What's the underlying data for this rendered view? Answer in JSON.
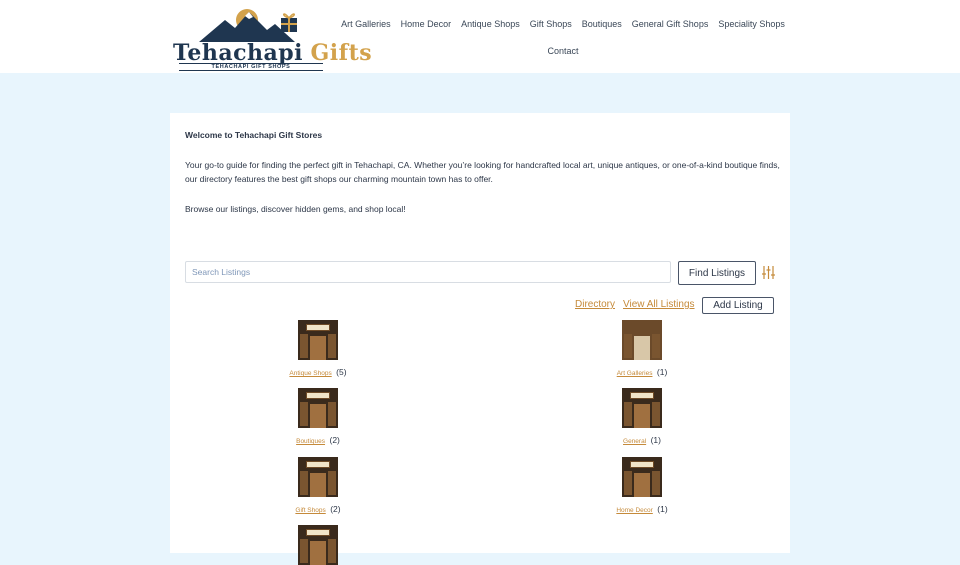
{
  "logo": {
    "word1": "Tehachapi",
    "word2": "Gifts",
    "tagline": "TEHACHAPI GIFT SHOPS"
  },
  "nav": {
    "row1": [
      "Art Galleries",
      "Home Decor",
      "Antique Shops",
      "Gift Shops",
      "Boutiques",
      "General Gift Shops",
      "Speciality Shops"
    ],
    "row2": [
      "Contact"
    ]
  },
  "main": {
    "welcome": "Welcome to Tehachapi Gift Stores",
    "intro": "Your go-to guide for finding the perfect gift in Tehachapi, CA. Whether you’re looking for handcrafted local art, unique antiques, or one-of-a-kind boutique finds, our directory features the best gift shops our charming mountain town has to offer.",
    "browse": "Browse our listings, discover hidden gems, and shop local!"
  },
  "search": {
    "placeholder": "Search Listings",
    "button": "Find Listings",
    "filter_icon": "sliders-icon"
  },
  "links": {
    "directory": "Directory",
    "view_all": "View All Listings",
    "add": "Add Listing"
  },
  "categories": [
    {
      "name": "Antique Shops",
      "count": "(5)"
    },
    {
      "name": "Art Galleries",
      "count": "(1)"
    },
    {
      "name": "Boutiques",
      "count": "(2)"
    },
    {
      "name": "General",
      "count": "(1)"
    },
    {
      "name": "Gift Shops",
      "count": "(2)"
    },
    {
      "name": "Home Decor",
      "count": "(1)"
    }
  ],
  "colors": {
    "page_bg": "#e8f5fd",
    "accent": "#c58a3a",
    "navy": "#1f3650",
    "gold": "#d3a24c"
  }
}
